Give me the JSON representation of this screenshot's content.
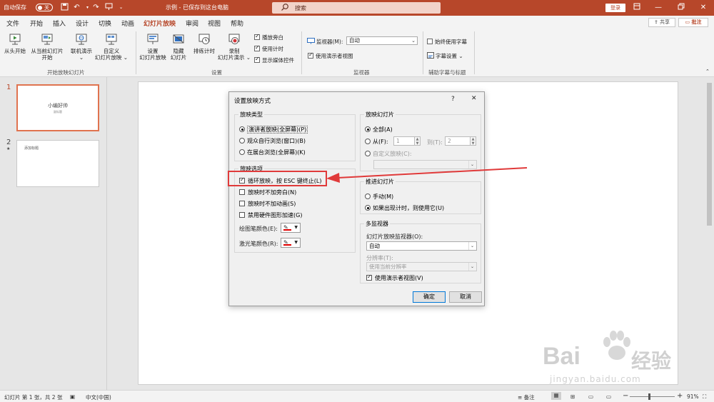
{
  "titlebar": {
    "autosave_label": "自动保存",
    "autosave_state": "关",
    "doc_title": "示例 - 已保存到这台电脑",
    "search_placeholder": "搜索",
    "login_label": "登录"
  },
  "menu": {
    "tabs": [
      "文件",
      "开始",
      "插入",
      "设计",
      "切换",
      "动画",
      "幻灯片放映",
      "审阅",
      "视图",
      "帮助"
    ],
    "active_tab": "幻灯片放映",
    "share_label": "共享",
    "comment_label": "批注"
  },
  "ribbon": {
    "group1_label": "开始放映幻灯片",
    "from_beginning": "从头开始",
    "from_current_1": "从当前幻灯片",
    "from_current_2": "开始",
    "online_1": "联机演示",
    "online_2": "⌄",
    "custom_1": "自定义",
    "custom_2": "幻灯片放映 ⌄",
    "setup_1": "设置",
    "setup_2": "幻灯片放映",
    "hide_1": "隐藏",
    "hide_2": "幻灯片",
    "rehearse": "排练计时",
    "record_1": "录制",
    "record_2": "幻灯片演示 ⌄",
    "play_narration": "播放旁白",
    "use_timings": "使用计时",
    "show_media": "显示媒体控件",
    "group2_label": "设置",
    "monitor_label": "监视器(M):",
    "monitor_value": "自动",
    "presenter_view": "使用演示者视图",
    "group3_label": "监视器",
    "always_subtitles": "始终使用字幕",
    "subtitle_settings": "字幕设置 ⌄",
    "group4_label": "辅助字幕与标题"
  },
  "slides": [
    {
      "num": "1",
      "title": "小编好帅",
      "subtitle": "副标题"
    },
    {
      "num": "2",
      "title": "添加标题",
      "star": "★"
    }
  ],
  "dialog": {
    "title": "设置放映方式",
    "help": "?",
    "close": "✕",
    "show_type": {
      "legend": "放映类型",
      "opt1": "演讲者放映(全屏幕)(P)",
      "opt2": "观众自行浏览(窗口)(B)",
      "opt3": "在展台浏览(全屏幕)(K)"
    },
    "show_options": {
      "legend": "放映选项",
      "loop": "循环放映，按 ESC 键终止(L)",
      "no_narration": "放映时不加旁白(N)",
      "no_animation": "放映时不加动画(S)",
      "no_hw_accel": "禁用硬件图形加速(G)",
      "pen_color": "绘图笔颜色(E):",
      "laser_color": "激光笔颜色(R):"
    },
    "show_slides": {
      "legend": "放映幻灯片",
      "all": "全部(A)",
      "from": "从(F):",
      "from_value": "1",
      "to": "到(T):",
      "to_value": "2",
      "custom": "自定义放映(C):"
    },
    "advance": {
      "legend": "推进幻灯片",
      "manual": "手动(M)",
      "timings": "如果出现计时，则使用它(U)"
    },
    "multi_monitor": {
      "legend": "多监视器",
      "monitor_label": "幻灯片放映监视器(O):",
      "monitor_value": "自动",
      "resolution_label": "分辨率(T):",
      "resolution_value": "使用当前分辨率",
      "presenter_view": "使用演示者视图(V)"
    },
    "ok": "确定",
    "cancel": "取消"
  },
  "statusbar": {
    "slide_info": "幻灯片 第 1 张，共 2 张",
    "language": "中文(中国)",
    "notes": "备注",
    "zoom_minus": "−",
    "zoom_plus": "+",
    "zoom": "91%"
  },
  "watermark": {
    "brand": "Bai",
    "brand2": "经验",
    "url": "jingyan.baidu.com"
  },
  "colors": {
    "accent": "#b7472a",
    "arrow": "#e03a3a"
  }
}
